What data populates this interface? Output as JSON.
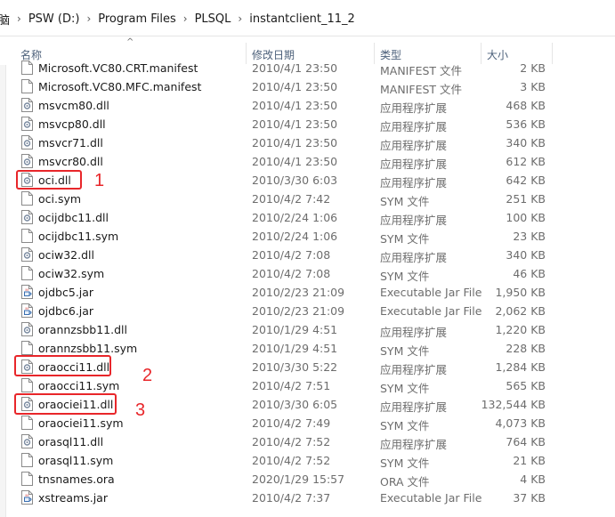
{
  "breadcrumb": {
    "items": [
      "脑",
      "PSW (D:)",
      "Program Files",
      "PLSQL",
      "instantclient_11_2"
    ],
    "separator": "›"
  },
  "columns": {
    "name": "名称",
    "date": "修改日期",
    "type": "类型",
    "size": "大小"
  },
  "files": [
    {
      "name": "Microsoft.VC80.CRT.manifest",
      "date": "2010/4/1 23:50",
      "type": "MANIFEST 文件",
      "size": "2 KB",
      "icon": "generic-file-icon"
    },
    {
      "name": "Microsoft.VC80.MFC.manifest",
      "date": "2010/4/1 23:50",
      "type": "MANIFEST 文件",
      "size": "3 KB",
      "icon": "generic-file-icon"
    },
    {
      "name": "msvcm80.dll",
      "date": "2010/4/1 23:50",
      "type": "应用程序扩展",
      "size": "468 KB",
      "icon": "dll-gear-icon"
    },
    {
      "name": "msvcp80.dll",
      "date": "2010/4/1 23:50",
      "type": "应用程序扩展",
      "size": "536 KB",
      "icon": "dll-gear-icon"
    },
    {
      "name": "msvcr71.dll",
      "date": "2010/4/1 23:50",
      "type": "应用程序扩展",
      "size": "340 KB",
      "icon": "dll-gear-icon"
    },
    {
      "name": "msvcr80.dll",
      "date": "2010/4/1 23:50",
      "type": "应用程序扩展",
      "size": "612 KB",
      "icon": "dll-gear-icon"
    },
    {
      "name": "oci.dll",
      "date": "2010/3/30 6:03",
      "type": "应用程序扩展",
      "size": "642 KB",
      "icon": "dll-gear-icon"
    },
    {
      "name": "oci.sym",
      "date": "2010/4/2 7:42",
      "type": "SYM 文件",
      "size": "251 KB",
      "icon": "generic-file-icon"
    },
    {
      "name": "ocijdbc11.dll",
      "date": "2010/2/24 1:06",
      "type": "应用程序扩展",
      "size": "100 KB",
      "icon": "dll-gear-icon"
    },
    {
      "name": "ocijdbc11.sym",
      "date": "2010/2/24 1:06",
      "type": "SYM 文件",
      "size": "23 KB",
      "icon": "generic-file-icon"
    },
    {
      "name": "ociw32.dll",
      "date": "2010/4/2 7:08",
      "type": "应用程序扩展",
      "size": "340 KB",
      "icon": "dll-gear-icon"
    },
    {
      "name": "ociw32.sym",
      "date": "2010/4/2 7:08",
      "type": "SYM 文件",
      "size": "46 KB",
      "icon": "generic-file-icon"
    },
    {
      "name": "ojdbc5.jar",
      "date": "2010/2/23 21:09",
      "type": "Executable Jar File",
      "size": "1,950 KB",
      "icon": "jar-file-icon"
    },
    {
      "name": "ojdbc6.jar",
      "date": "2010/2/23 21:09",
      "type": "Executable Jar File",
      "size": "2,062 KB",
      "icon": "jar-file-icon"
    },
    {
      "name": "orannzsbb11.dll",
      "date": "2010/1/29 4:51",
      "type": "应用程序扩展",
      "size": "1,220 KB",
      "icon": "dll-gear-icon"
    },
    {
      "name": "orannzsbb11.sym",
      "date": "2010/1/29 4:51",
      "type": "SYM 文件",
      "size": "228 KB",
      "icon": "generic-file-icon"
    },
    {
      "name": "oraocci11.dll",
      "date": "2010/3/30 5:22",
      "type": "应用程序扩展",
      "size": "1,284 KB",
      "icon": "dll-gear-icon"
    },
    {
      "name": "oraocci11.sym",
      "date": "2010/4/2 7:51",
      "type": "SYM 文件",
      "size": "565 KB",
      "icon": "generic-file-icon"
    },
    {
      "name": "oraociei11.dll",
      "date": "2010/3/30 6:05",
      "type": "应用程序扩展",
      "size": "132,544 KB",
      "icon": "dll-gear-icon"
    },
    {
      "name": "oraociei11.sym",
      "date": "2010/4/2 7:49",
      "type": "SYM 文件",
      "size": "4,073 KB",
      "icon": "generic-file-icon"
    },
    {
      "name": "orasql11.dll",
      "date": "2010/4/2 7:52",
      "type": "应用程序扩展",
      "size": "764 KB",
      "icon": "dll-gear-icon"
    },
    {
      "name": "orasql11.sym",
      "date": "2010/4/2 7:52",
      "type": "SYM 文件",
      "size": "21 KB",
      "icon": "generic-file-icon"
    },
    {
      "name": "tnsnames.ora",
      "date": "2020/1/29 15:57",
      "type": "ORA 文件",
      "size": "4 KB",
      "icon": "generic-file-icon"
    },
    {
      "name": "xstreams.jar",
      "date": "2010/4/2 7:37",
      "type": "Executable Jar File",
      "size": "37 KB",
      "icon": "jar-file-icon"
    }
  ],
  "annotations": [
    {
      "label": "1",
      "file": "oci.dll"
    },
    {
      "label": "2",
      "file": "oraocci11.dll"
    },
    {
      "label": "3",
      "file": "oraociei11.dll"
    }
  ],
  "colors": {
    "annotation": "#e8262a",
    "header_text": "#4c607a",
    "secondary_text": "#6d6d6d"
  }
}
